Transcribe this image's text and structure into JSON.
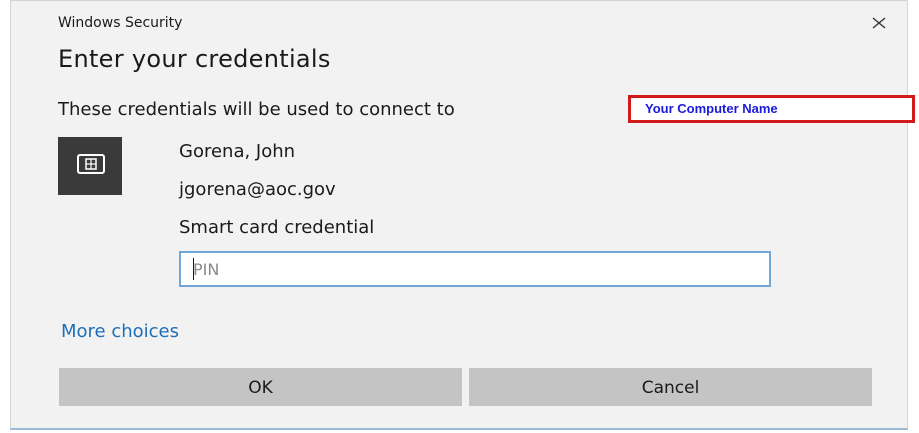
{
  "window": {
    "title": "Windows Security",
    "close_icon": "close-icon"
  },
  "dialog": {
    "heading": "Enter your credentials",
    "connect_text": "These credentials will be used to connect to",
    "computer_name": "Your Computer Name"
  },
  "credential": {
    "icon": "smart-card-icon",
    "name": "Gorena, John",
    "email": "jgorena@aoc.gov",
    "type": "Smart card credential"
  },
  "pin": {
    "value": "",
    "placeholder": "PIN"
  },
  "more_choices": "More choices",
  "buttons": {
    "ok": "OK",
    "cancel": "Cancel"
  },
  "colors": {
    "link": "#1d6fb8",
    "input_border": "#6fa7d8",
    "highlight_border": "#d11a1a",
    "highlight_text": "#1a1adc"
  }
}
